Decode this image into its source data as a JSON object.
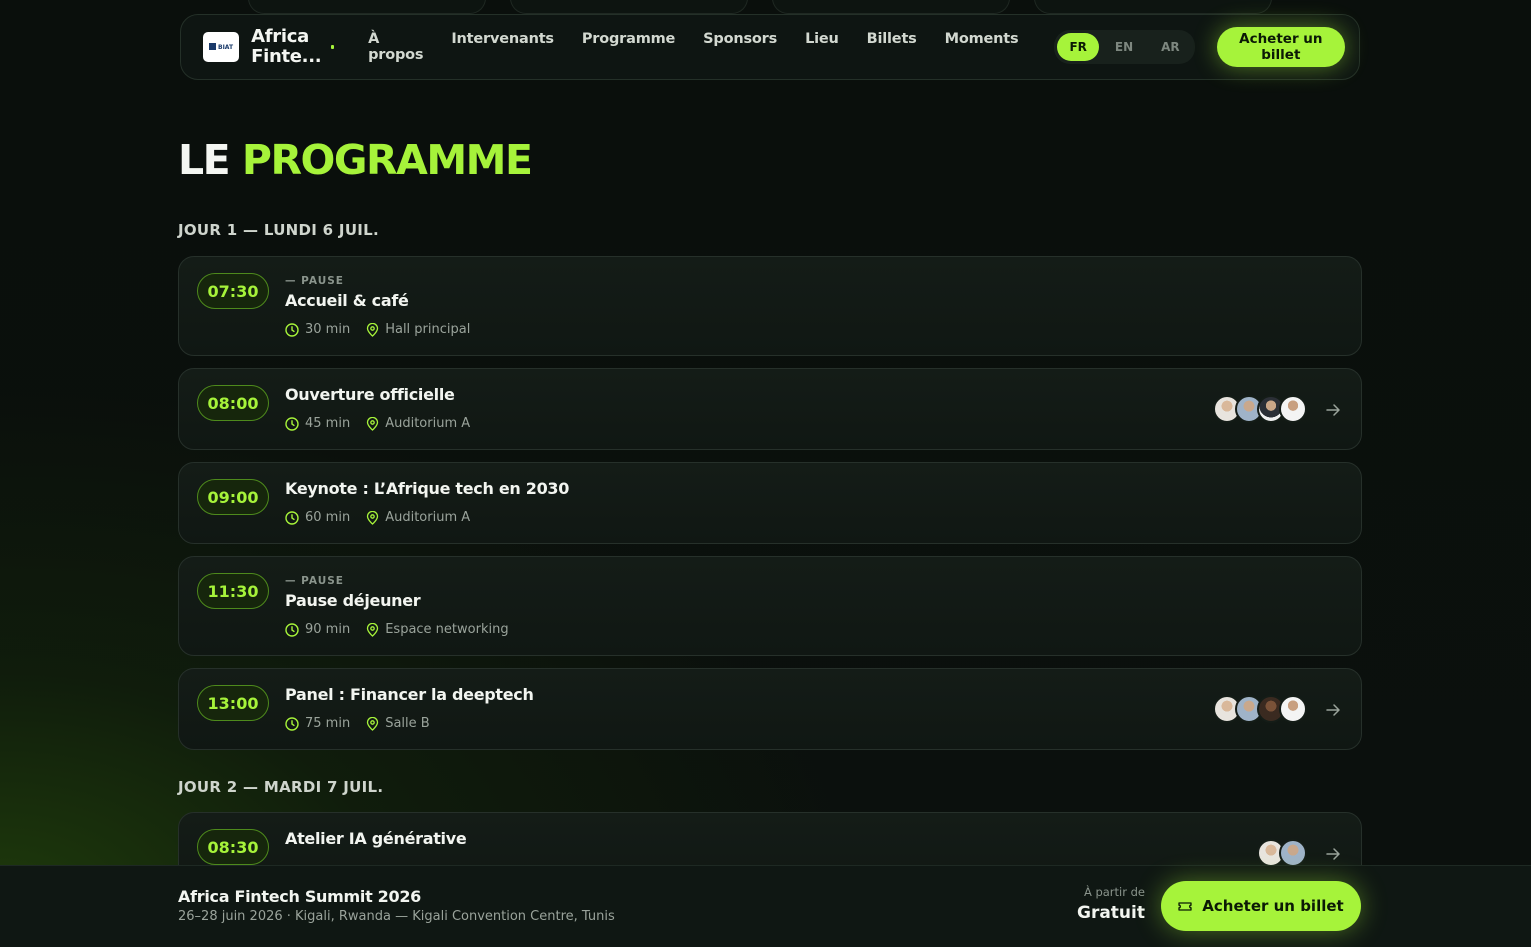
{
  "nav": {
    "brand": "Africa Finte...",
    "logo_text": "BIAT",
    "links": [
      "À propos",
      "Intervenants",
      "Programme",
      "Sponsors",
      "Lieu",
      "Billets",
      "Moments"
    ],
    "languages": [
      "FR",
      "EN",
      "AR"
    ],
    "active_language": "FR",
    "cta": "Acheter un billet"
  },
  "heading": {
    "word1": "LE",
    "word2": "PROGRAMME"
  },
  "days": [
    {
      "title": "JOUR 1 — LUNDI 6 JUIL.",
      "sessions": [
        {
          "time": "07:30",
          "tag": "— PAUSE",
          "title": "Accueil & café",
          "duration": "30 min",
          "location": "Hall principal",
          "speakers": 0
        },
        {
          "time": "08:00",
          "tag": "",
          "title": "Ouverture officielle",
          "duration": "45 min",
          "location": "Auditorium A",
          "speakers": 4
        },
        {
          "time": "09:00",
          "tag": "",
          "title": "Keynote : L’Afrique tech en 2030",
          "duration": "60 min",
          "location": "Auditorium A",
          "speakers": 0
        },
        {
          "time": "11:30",
          "tag": "— PAUSE",
          "title": "Pause déjeuner",
          "duration": "90 min",
          "location": "Espace networking",
          "speakers": 0
        },
        {
          "time": "13:00",
          "tag": "",
          "title": "Panel : Financer la deeptech",
          "duration": "75 min",
          "location": "Salle B",
          "speakers": 4
        }
      ]
    },
    {
      "title": "JOUR 2 — MARDI 7 JUIL.",
      "sessions": [
        {
          "time": "08:30",
          "tag": "",
          "title": "Atelier IA générative",
          "duration": "",
          "location": "",
          "speakers": 2
        }
      ]
    }
  ],
  "footer": {
    "title": "Africa Fintech Summit 2026",
    "subtitle": "26–28 juin 2026 · Kigali, Rwanda — Kigali Convention Centre, Tunis",
    "from_label": "À partir de",
    "price": "Gratuit",
    "cta": "Acheter un billet"
  },
  "colors": {
    "accent": "#a6f33a",
    "background": "#0a0f0c",
    "card": "#131b16"
  }
}
